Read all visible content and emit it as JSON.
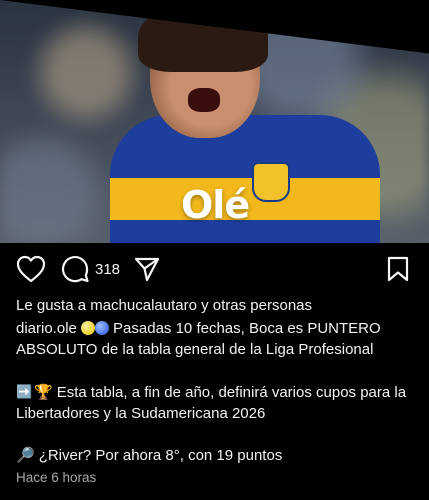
{
  "post_image": {
    "brand_logo": "Olé"
  },
  "actions": {
    "comment_count": "318"
  },
  "likes": {
    "text": "Le gusta a machucalautaro y otras personas"
  },
  "caption": {
    "username": "diario.ole",
    "line1_emoji": "🟡🔵",
    "paragraph1": "Pasadas 10 fechas, Boca es PUNTERO ABSOLUTO de la tabla general de la Liga Profesional",
    "paragraph2_emoji_soon": "➡️",
    "paragraph2_emoji_trophy": "🏆",
    "paragraph2": "Esta tabla, a fin de año, definirá varios cupos para la Libertadores y la Sudamericana 2026",
    "paragraph3_emoji": "🔎",
    "paragraph3": "¿River? Por ahora 8°, con 19 puntos"
  },
  "timestamp": "Hace 6 horas",
  "colors": {
    "background": "#000000",
    "text": "#f2f2f2",
    "muted": "#a8a8a8",
    "jersey_blue": "#1d3e9c",
    "jersey_gold": "#f2b81c"
  }
}
